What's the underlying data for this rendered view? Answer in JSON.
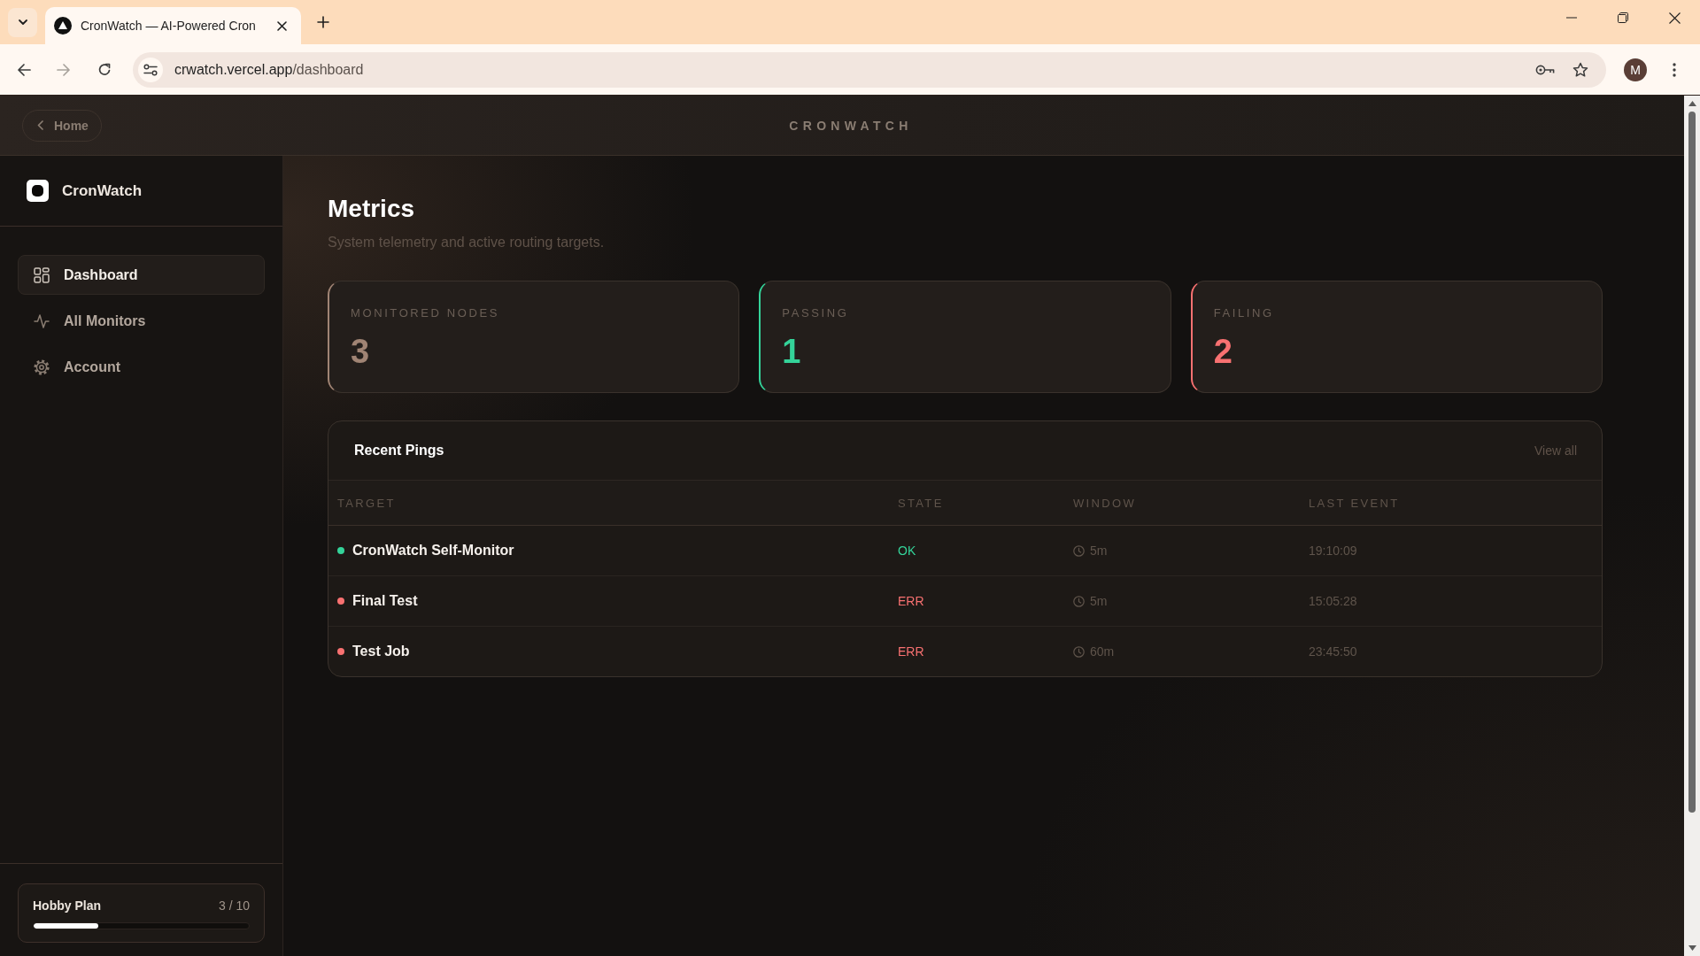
{
  "browser": {
    "tabs": [
      {
        "title": "CronWatch — AI-Powered Cron",
        "selected": true
      }
    ],
    "forward_disabled": true,
    "url_host": "crwatch.vercel.app",
    "url_path": "/dashboard",
    "profile_initial": "M"
  },
  "header": {
    "back_label": "Home",
    "brand": "CRONWATCH"
  },
  "sidebar": {
    "brand": "CronWatch",
    "items": [
      {
        "label": "Dashboard",
        "selected": true
      },
      {
        "label": "All Monitors",
        "selected": false
      },
      {
        "label": "Account",
        "selected": false
      }
    ],
    "plan": {
      "name": "Hobby Plan",
      "usage": "3 / 10",
      "level": 0.3
    }
  },
  "page": {
    "title": "Metrics",
    "subtitle": "System telemetry and active routing targets."
  },
  "stats": [
    {
      "label": "MONITORED NODES",
      "value": "3",
      "color": "#a08474"
    },
    {
      "label": "PASSING",
      "value": "1",
      "color": "#34d399"
    },
    {
      "label": "FAILING",
      "value": "2",
      "color": "#f87171"
    }
  ],
  "recent_pings": {
    "title": "Recent Pings",
    "link": "View all",
    "columns": [
      "TARGET",
      "STATE",
      "WINDOW",
      "LAST EVENT"
    ],
    "rows": [
      {
        "target": "CronWatch Self-Monitor",
        "healthy": true,
        "state": "OK",
        "window": "5m",
        "last_event": "19:10:09"
      },
      {
        "target": "Final Test",
        "healthy": false,
        "state": "ERR",
        "window": "5m",
        "last_event": "15:05:28"
      },
      {
        "target": "Test Job",
        "healthy": false,
        "state": "ERR",
        "window": "60m",
        "last_event": "23:45:50"
      }
    ]
  }
}
